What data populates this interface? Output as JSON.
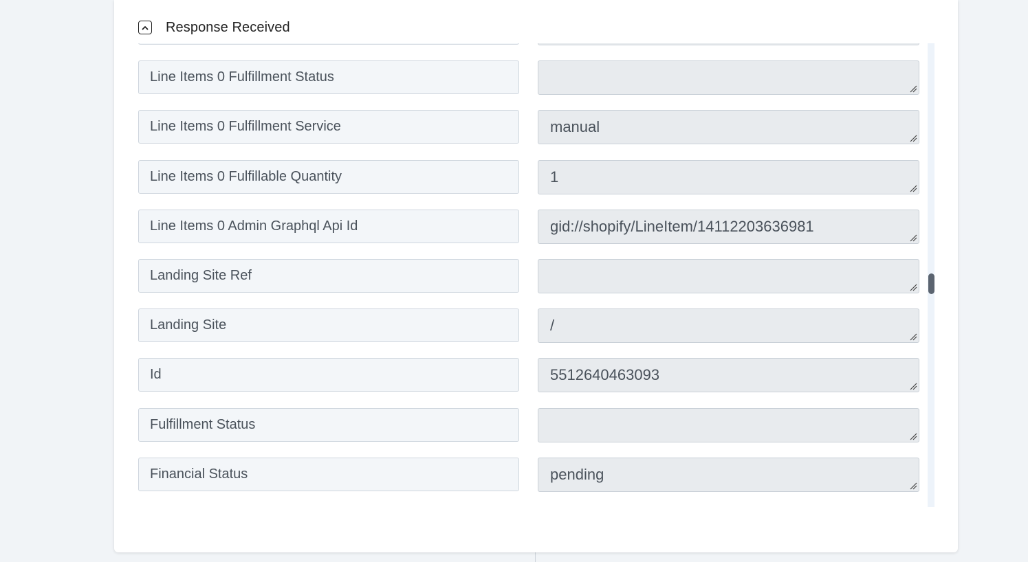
{
  "section": {
    "title": "Response Received",
    "toggle_icon": "chevron-up-icon"
  },
  "fields": [
    {
      "key": "",
      "value": ""
    },
    {
      "key": "Line Items 0 Fulfillment Status",
      "value": ""
    },
    {
      "key": "Line Items 0 Fulfillment Service",
      "value": "manual"
    },
    {
      "key": "Line Items 0 Fulfillable Quantity",
      "value": "1"
    },
    {
      "key": "Line Items 0 Admin Graphql Api Id",
      "value": "gid://shopify/LineItem/14112203636981"
    },
    {
      "key": "Landing Site Ref",
      "value": ""
    },
    {
      "key": "Landing Site",
      "value": "/"
    },
    {
      "key": "Id",
      "value": "5512640463093"
    },
    {
      "key": "Fulfillment Status",
      "value": ""
    },
    {
      "key": "Financial Status",
      "value": "pending"
    },
    {
      "key": "",
      "value": ""
    }
  ],
  "scrollbar": {
    "position_fraction": 0.52
  },
  "colors": {
    "key_background": "#f3f6f9",
    "value_background": "#e8ebee",
    "scroll_thumb": "#5b6470"
  }
}
